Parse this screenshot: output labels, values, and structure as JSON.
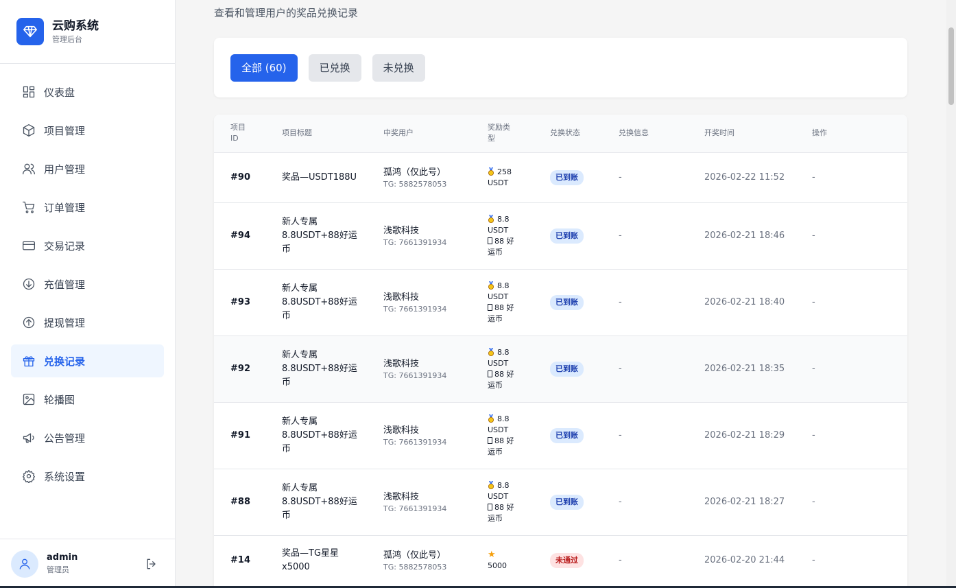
{
  "brand": {
    "title": "云购系统",
    "subtitle": "管理后台"
  },
  "nav": [
    {
      "label": "仪表盘",
      "icon": "dashboard-icon"
    },
    {
      "label": "项目管理",
      "icon": "cube-icon"
    },
    {
      "label": "用户管理",
      "icon": "users-icon"
    },
    {
      "label": "订单管理",
      "icon": "cart-icon"
    },
    {
      "label": "交易记录",
      "icon": "card-icon"
    },
    {
      "label": "充值管理",
      "icon": "arrow-down-circle-icon"
    },
    {
      "label": "提现管理",
      "icon": "arrow-up-circle-icon"
    },
    {
      "label": "兑换记录",
      "icon": "gift-icon",
      "active": true
    },
    {
      "label": "轮播图",
      "icon": "image-icon"
    },
    {
      "label": "公告管理",
      "icon": "megaphone-icon"
    },
    {
      "label": "系统设置",
      "icon": "gear-icon"
    }
  ],
  "user": {
    "name": "admin",
    "role": "管理员"
  },
  "page": {
    "subtitle": "查看和管理用户的奖品兑换记录"
  },
  "filters": [
    {
      "label": "全部 (60)",
      "active": true
    },
    {
      "label": "已兑换"
    },
    {
      "label": "未兑换"
    }
  ],
  "table": {
    "headers": [
      "项目\nID",
      "项目标题",
      "中奖用户",
      "奖励类\n型",
      "兑换状态",
      "兑换信息",
      "开奖时间",
      "操作"
    ],
    "rows": [
      {
        "id": "#90",
        "title": "奖品—USDT188U",
        "user": "孤鸿（仅此号）",
        "tg": "TG: 5882578053",
        "reward1": "258",
        "reward1_unit": "USDT",
        "reward2": "",
        "reward2_unit": "",
        "status": "已到账",
        "status_type": "ok",
        "info": "-",
        "time": "2026-02-22 11:52",
        "action": "-"
      },
      {
        "id": "#94",
        "title": "新人专属8.8USDT+88好运币",
        "user": "浅歌科技",
        "tg": "TG: 7661391934",
        "reward1": "8.8",
        "reward1_unit": "USDT",
        "reward2": "88 好",
        "reward2_unit": "运币",
        "status": "已到账",
        "status_type": "ok",
        "info": "-",
        "time": "2026-02-21 18:46",
        "action": "-"
      },
      {
        "id": "#93",
        "title": "新人专属8.8USDT+88好运币",
        "user": "浅歌科技",
        "tg": "TG: 7661391934",
        "reward1": "8.8",
        "reward1_unit": "USDT",
        "reward2": "88 好",
        "reward2_unit": "运币",
        "status": "已到账",
        "status_type": "ok",
        "info": "-",
        "time": "2026-02-21 18:40",
        "action": "-"
      },
      {
        "id": "#92",
        "title": "新人专属8.8USDT+88好运币",
        "user": "浅歌科技",
        "tg": "TG: 7661391934",
        "reward1": "8.8",
        "reward1_unit": "USDT",
        "reward2": "88 好",
        "reward2_unit": "运币",
        "status": "已到账",
        "status_type": "ok",
        "info": "-",
        "time": "2026-02-21 18:35",
        "action": "-"
      },
      {
        "id": "#91",
        "title": "新人专属8.8USDT+88好运币",
        "user": "浅歌科技",
        "tg": "TG: 7661391934",
        "reward1": "8.8",
        "reward1_unit": "USDT",
        "reward2": "88 好",
        "reward2_unit": "运币",
        "status": "已到账",
        "status_type": "ok",
        "info": "-",
        "time": "2026-02-21 18:29",
        "action": "-"
      },
      {
        "id": "#88",
        "title": "新人专属8.8USDT+88好运币",
        "user": "浅歌科技",
        "tg": "TG: 7661391934",
        "reward1": "8.8",
        "reward1_unit": "USDT",
        "reward2": "88 好",
        "reward2_unit": "运币",
        "status": "已到账",
        "status_type": "ok",
        "info": "-",
        "time": "2026-02-21 18:27",
        "action": "-"
      },
      {
        "id": "#14",
        "title": "奖品—TG星星x5000",
        "user": "孤鸿（仅此号）",
        "tg": "TG: 5882578053",
        "reward1": "",
        "reward1_unit": "5000",
        "reward2": "",
        "reward2_unit": "",
        "status": "未通过",
        "status_type": "no",
        "info": "-",
        "time": "2026-02-20 21:44",
        "action": "-"
      }
    ]
  },
  "colors": {
    "primary": "#2563eb",
    "success_bg": "#dbeafe",
    "danger_bg": "#fee2e2"
  }
}
